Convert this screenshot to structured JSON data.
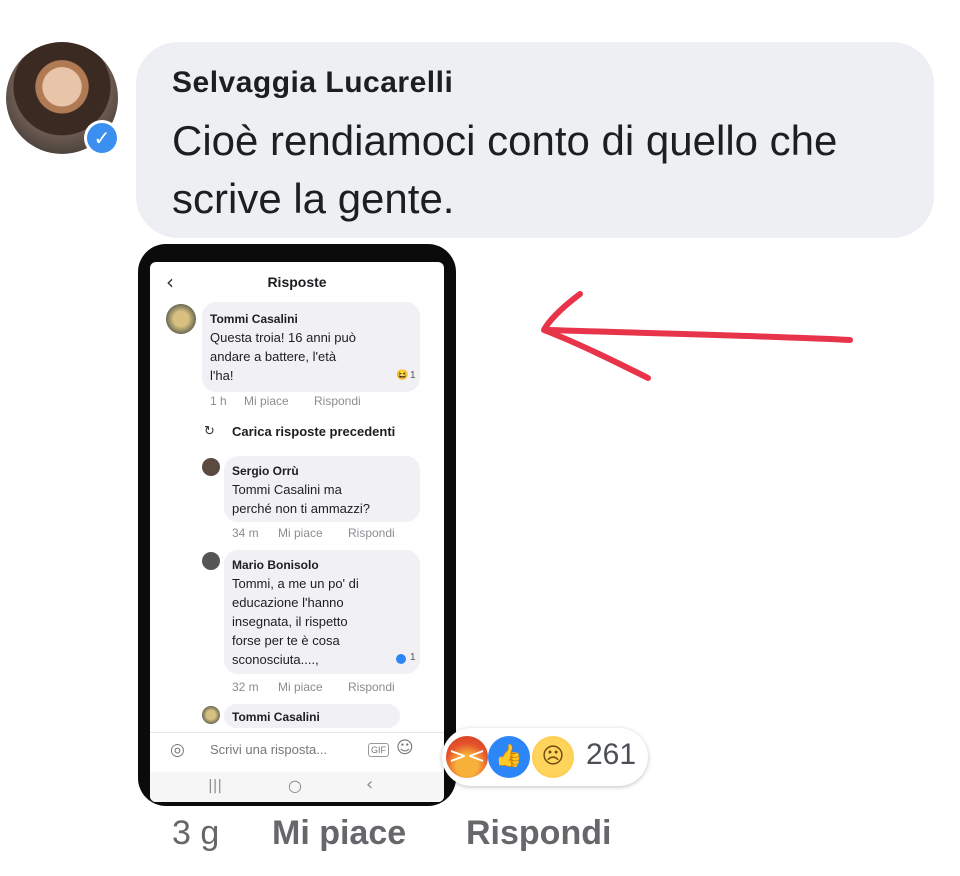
{
  "comment": {
    "author": "Selvaggia Lucarelli",
    "text": "Cioè rendiamoci conto di quello che scrive la gente.",
    "time": "3 g",
    "like_label": "Mi piace",
    "reply_label": "Rispondi",
    "reaction_count": "261",
    "reactions": [
      "angry-icon",
      "like-icon",
      "sad-icon"
    ]
  },
  "screenshot": {
    "header_title": "Risposte",
    "load_previous": "Carica risposte precedenti",
    "comments": [
      {
        "author": "Tommi Casalini",
        "lines": [
          "Questa troia! 16 anni può",
          "andare a battere, l'età",
          "l'ha!"
        ],
        "time": "1 h",
        "like": "Mi piace",
        "reply": "Rispondi",
        "reaction_count": "1"
      },
      {
        "author": "Sergio Orrù",
        "lines": [
          "Tommi Casalini ma",
          "perché non ti ammazzi?"
        ],
        "time": "34 m",
        "like": "Mi piace",
        "reply": "Rispondi"
      },
      {
        "author": "Mario Bonisolo",
        "lines": [
          "Tommi, a me un po' di",
          "educazione l'hanno",
          "insegnata, il rispetto",
          "forse per te è cosa",
          "sconosciuta....,"
        ],
        "time": "32 m",
        "like": "Mi piace",
        "reply": "Rispondi",
        "reaction_count": "1"
      },
      {
        "author": "Tommi Casalini"
      }
    ],
    "reply_placeholder": "Scrivi una risposta...",
    "gif_label": "GIF"
  },
  "colors": {
    "bubble": "#eeeff2",
    "annotation_arrow": "#e8344a",
    "verified": "#3b8ff0",
    "meta_text": "#65676b"
  }
}
